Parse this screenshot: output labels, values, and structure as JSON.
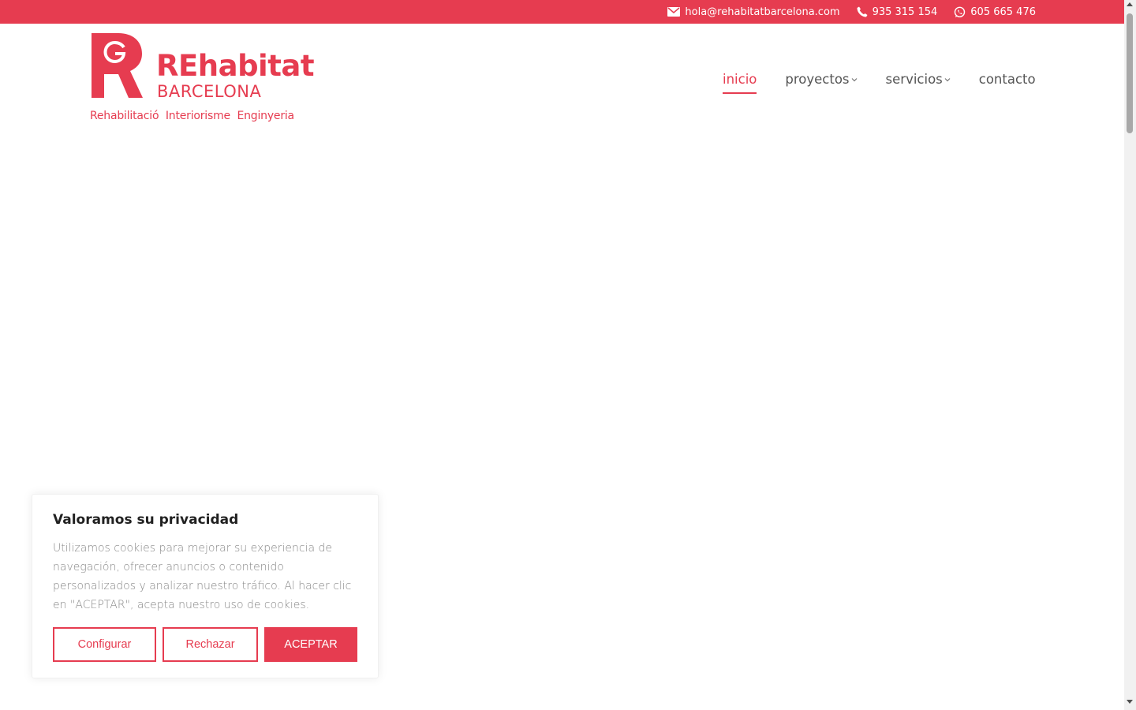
{
  "topbar": {
    "email": "hola@rehabitatbarcelona.com",
    "phone": "935 315 154",
    "whatsapp": "605 665 476"
  },
  "logo": {
    "name": "REhabitat",
    "city": "BARCELONA",
    "tagline": "Rehabilitació  Interiorisme  Enginyeria"
  },
  "nav": {
    "items": [
      {
        "label": "inicio",
        "active": true
      },
      {
        "label": "proyectos",
        "dropdown": true
      },
      {
        "label": "servicios",
        "dropdown": true
      },
      {
        "label": "contacto"
      }
    ]
  },
  "cookie": {
    "title": "Valoramos su privacidad",
    "text": "Utilizamos cookies para mejorar su experiencia de navegación, ofrecer anuncios o contenido personalizados y analizar nuestro tráfico. Al hacer clic en \"ACEPTAR\", acepta nuestro uso de cookies.",
    "configure_label": "Configurar",
    "reject_label": "Rechazar",
    "accept_label": "ACEPTAR"
  },
  "colors": {
    "brand": "#e63c50",
    "text": "#555555"
  },
  "icons": [
    "mail-icon",
    "phone-icon",
    "whatsapp-icon",
    "chevron-down-icon"
  ]
}
